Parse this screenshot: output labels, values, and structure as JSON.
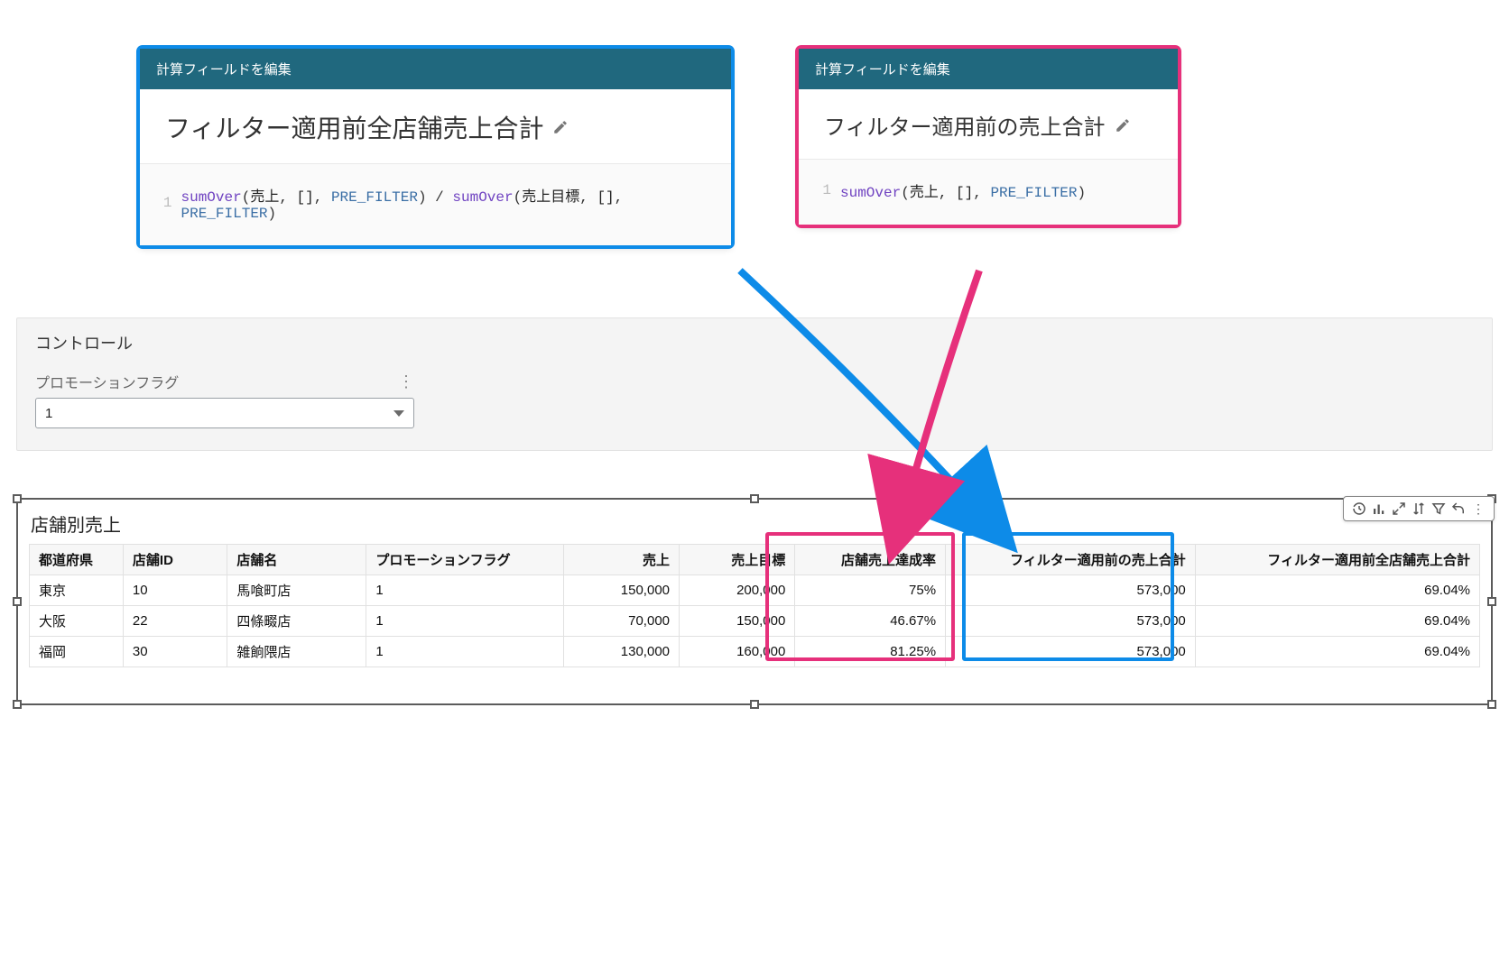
{
  "calc_left": {
    "header": "計算フィールドを編集",
    "title": "フィルター適用前全店舗売上合計",
    "code_line": "1",
    "fn1": "sumOver",
    "arg1a": "売上",
    "arg1b": "[]",
    "kw": "PRE_FILTER",
    "div": " / ",
    "fn2": "sumOver",
    "arg2a": "売上目標"
  },
  "calc_right": {
    "header": "計算フィールドを編集",
    "title": "フィルター適用前の売上合計",
    "code_line": "1",
    "fn1": "sumOver",
    "arg1a": "売上",
    "arg1b": "[]",
    "kw": "PRE_FILTER"
  },
  "controls": {
    "section_label": "コントロール",
    "filter_label": "プロモーションフラグ",
    "filter_value": "1"
  },
  "visual": {
    "title": "店舗別売上",
    "columns": {
      "pref": "都道府県",
      "store_id": "店舗ID",
      "store_name": "店舗名",
      "promo": "プロモーションフラグ",
      "sales": "売上",
      "target": "売上目標",
      "achieve": "店舗売上達成率",
      "pre_sum": "フィルター適用前の売上合計",
      "pre_all": "フィルター適用前全店舗売上合計"
    },
    "rows": [
      {
        "pref": "東京",
        "store_id": "10",
        "store_name": "馬喰町店",
        "promo": "1",
        "sales": "150,000",
        "target": "200,000",
        "achieve": "75%",
        "pre_sum": "573,000",
        "pre_all": "69.04%"
      },
      {
        "pref": "大阪",
        "store_id": "22",
        "store_name": "四條畷店",
        "promo": "1",
        "sales": "70,000",
        "target": "150,000",
        "achieve": "46.67%",
        "pre_sum": "573,000",
        "pre_all": "69.04%"
      },
      {
        "pref": "福岡",
        "store_id": "30",
        "store_name": "雑餉隈店",
        "promo": "1",
        "sales": "130,000",
        "target": "160,000",
        "achieve": "81.25%",
        "pre_sum": "573,000",
        "pre_all": "69.04%"
      }
    ]
  }
}
